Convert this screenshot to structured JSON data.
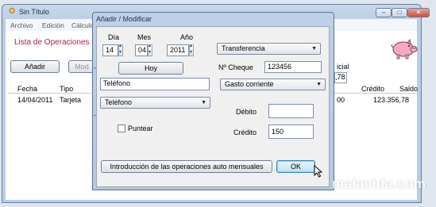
{
  "window": {
    "title": "Sin Título",
    "min": "–",
    "max": "□",
    "close": "✕"
  },
  "menu": [
    "Archivo",
    "Edición",
    "Cálculo"
  ],
  "main": {
    "heading": "Lista de Operaciones",
    "add_button": "Añadir",
    "mod_button_partial": "Mod",
    "partial_label": "icial",
    "partial_value": ",78",
    "columns": {
      "fecha": "Fecha",
      "tipo": "Tipo",
      "credito": "Crédito",
      "saldo": "Saldo"
    },
    "row": {
      "fecha": "14/04/2011",
      "tipo": "Tarjeta",
      "partial": "00",
      "saldo": "123.356,78"
    }
  },
  "dialog": {
    "title": "Añadir / Modificar",
    "dia_label": "Día",
    "mes_label": "Mes",
    "ano_label": "Año",
    "dia": "14",
    "mes": "04",
    "ano": "2011",
    "hoy": "Hoy",
    "descripcion": "Teléfono",
    "categoria": "Teléfono",
    "puntear": "Puntear",
    "tipo_operacion": "Transferencia",
    "cheque_label": "Nº Cheque",
    "cheque": "123456",
    "clase": "Gasto corriente",
    "debito_label": "Débito",
    "debito": "",
    "credito_label": "Crédito",
    "credito": "150",
    "auto_button": "Introducción de las operaciones auto mensuales",
    "ok_button": "OK"
  },
  "watermark": "malavida.com"
}
